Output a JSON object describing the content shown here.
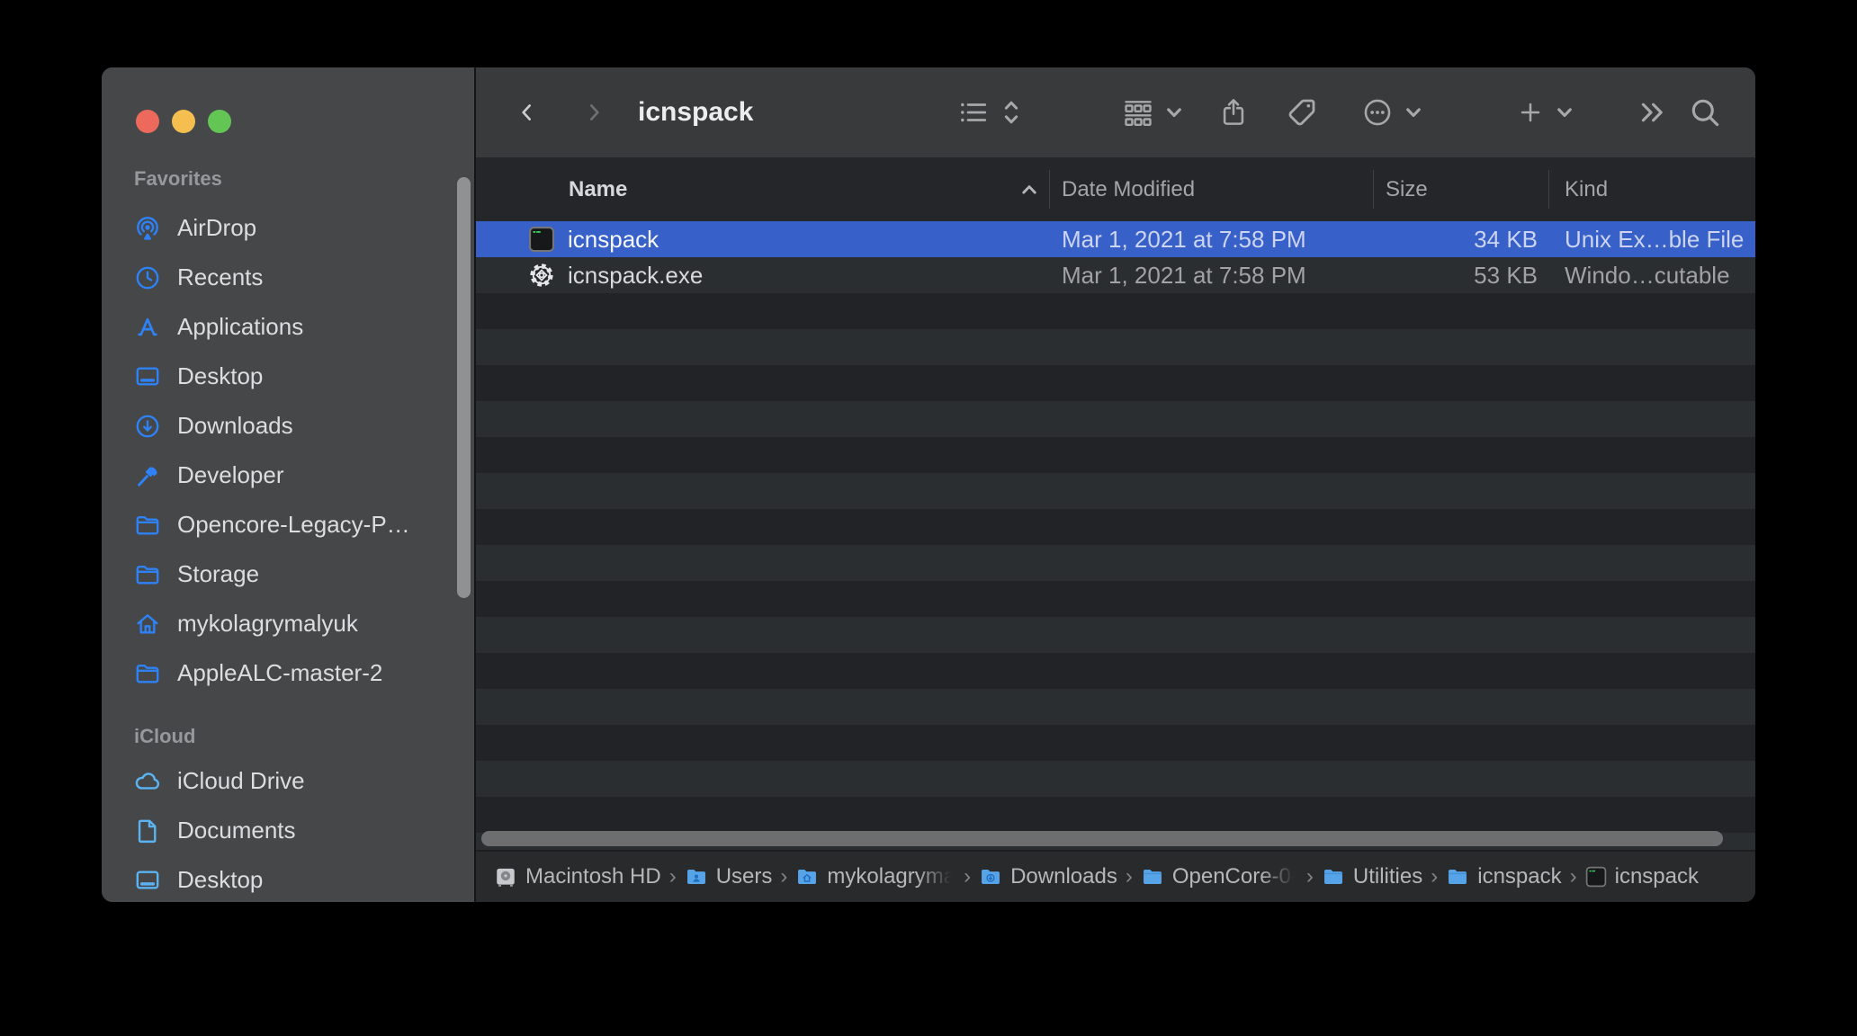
{
  "window": {
    "title": "icnspack",
    "traffic_lights": [
      {
        "name": "close",
        "color": "#ec695c"
      },
      {
        "name": "minimize",
        "color": "#f5bf4f"
      },
      {
        "name": "zoom",
        "color": "#62c554"
      }
    ]
  },
  "sidebar": {
    "sections": [
      {
        "header": "Favorites",
        "items": [
          {
            "label": "AirDrop",
            "icon": "airdrop-icon"
          },
          {
            "label": "Recents",
            "icon": "clock-icon"
          },
          {
            "label": "Applications",
            "icon": "appstore-icon"
          },
          {
            "label": "Desktop",
            "icon": "desktop-icon"
          },
          {
            "label": "Downloads",
            "icon": "download-circle-icon"
          },
          {
            "label": "Developer",
            "icon": "hammer-icon"
          },
          {
            "label": "Opencore-Legacy-P…",
            "icon": "folder-icon"
          },
          {
            "label": "Storage",
            "icon": "folder-icon"
          },
          {
            "label": "mykolagrymalyuk",
            "icon": "home-icon"
          },
          {
            "label": "AppleALC-master-2",
            "icon": "folder-icon"
          }
        ]
      },
      {
        "header": "iCloud",
        "items": [
          {
            "label": "iCloud Drive",
            "icon": "cloud-icon",
            "tint": "cyan"
          },
          {
            "label": "Documents",
            "icon": "document-icon",
            "tint": "cyan"
          },
          {
            "label": "Desktop",
            "icon": "desktop-icon",
            "tint": "cyan"
          }
        ]
      }
    ]
  },
  "columns": {
    "name": "Name",
    "date": "Date Modified",
    "size": "Size",
    "kind": "Kind",
    "sorted_by": "Name",
    "sort_direction": "ascending"
  },
  "files": [
    {
      "name": "icnspack",
      "icon": "terminal-executable-icon",
      "date": "Mar 1, 2021 at 7:58 PM",
      "size": "34 KB",
      "kind": "Unix Ex…ble File",
      "selected": true
    },
    {
      "name": "icnspack.exe",
      "icon": "gear-executable-icon",
      "date": "Mar 1, 2021 at 7:58 PM",
      "size": "53 KB",
      "kind": "Windo…cutable",
      "selected": false
    }
  ],
  "pathbar": {
    "items": [
      {
        "label": "Macintosh HD",
        "icon": "drive-icon"
      },
      {
        "label": "Users",
        "icon": "folder-users-icon"
      },
      {
        "label": "mykolagryma",
        "icon": "folder-home-icon",
        "faded": true
      },
      {
        "label": "Downloads",
        "icon": "folder-download-icon"
      },
      {
        "label": "OpenCore-0-",
        "icon": "folder-blue-icon",
        "faded": true
      },
      {
        "label": "Utilities",
        "icon": "folder-blue-icon"
      },
      {
        "label": "icnspack",
        "icon": "folder-blue-icon"
      },
      {
        "label": "icnspack",
        "icon": "terminal-executable-icon"
      }
    ],
    "separator": "›"
  },
  "colors": {
    "selection_blue": "#3760c9",
    "sidebar_icon_blue": "#2e82f6",
    "icloud_icon_blue": "#5bb3f2",
    "row_dark": "#212327",
    "row_light": "#2b2e31",
    "sidebar_bg": "#454749",
    "toolbar_bg": "#393a3c"
  }
}
